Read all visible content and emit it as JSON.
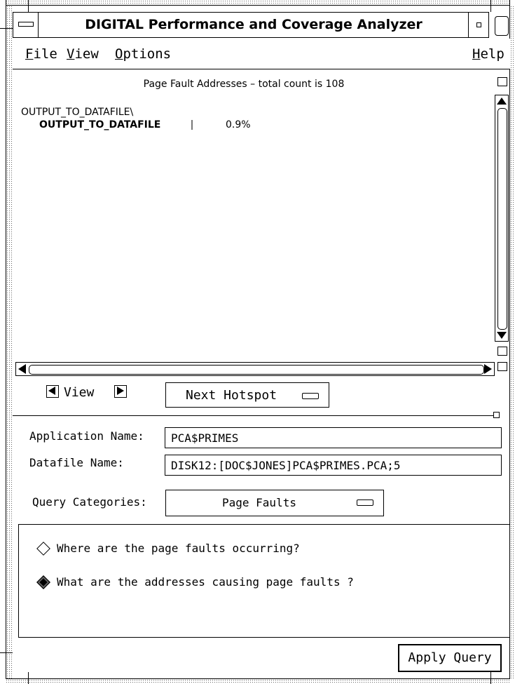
{
  "window": {
    "title": "DIGITAL Performance and Coverage Analyzer"
  },
  "menubar": {
    "items": [
      {
        "label": "File",
        "mnemonic": "F",
        "rest": "ile"
      },
      {
        "label": "View",
        "mnemonic": "V",
        "rest": "iew"
      },
      {
        "label": "Options",
        "mnemonic": "O",
        "rest": "ptions"
      },
      {
        "label": "Help",
        "mnemonic": "H",
        "rest": "elp"
      }
    ]
  },
  "display": {
    "title": "Page Fault Addresses – total count is 108",
    "tree_parent": "OUTPUT_TO_DATAFILE\\",
    "tree_child": "OUTPUT_TO_DATAFILE",
    "percent": "0.9%"
  },
  "navigation": {
    "view_label": "View",
    "hotspot_label": "Next Hotspot"
  },
  "form": {
    "application_label": "Application Name:",
    "application_value": "PCA$PRIMES",
    "datafile_label": "Datafile Name:",
    "datafile_value": "DISK12:[DOC$JONES]PCA$PRIMES.PCA;5",
    "query_label": "Query Categories:",
    "query_value": "Page Faults"
  },
  "queries": [
    {
      "label": "Where are the page faults occurring?",
      "selected": false
    },
    {
      "label": "What are the addresses causing page faults ?",
      "selected": true
    }
  ],
  "apply_button": "Apply Query"
}
